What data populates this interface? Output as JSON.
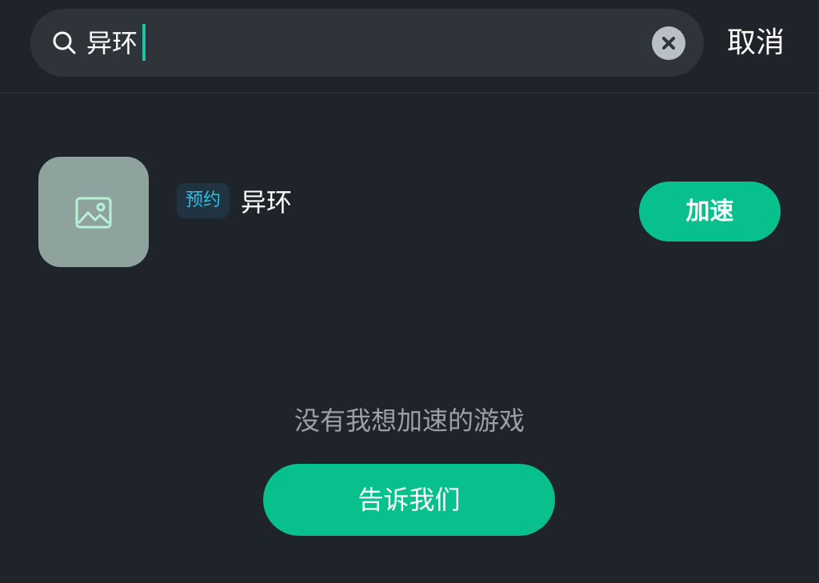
{
  "search": {
    "query": "异环",
    "cancel_label": "取消"
  },
  "result": {
    "tag": "预约",
    "title": "异环",
    "action_label": "加速"
  },
  "footer": {
    "prompt": "没有我想加速的游戏",
    "button_label": "告诉我们"
  },
  "colors": {
    "background": "#1f242b",
    "search_bg": "#2f343b",
    "accent": "#08bf8e",
    "caret": "#19c5a2",
    "tag_text": "#27c3e6"
  },
  "icons": {
    "search": "search-icon",
    "clear": "clear-icon",
    "thumbnail": "image-placeholder-icon"
  }
}
